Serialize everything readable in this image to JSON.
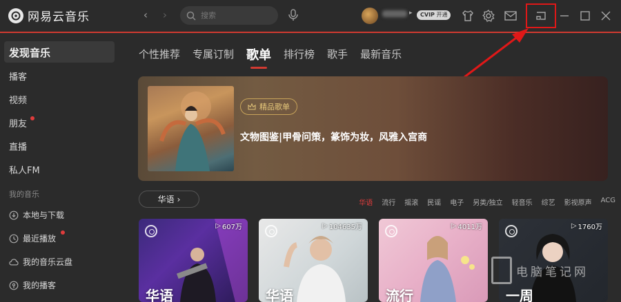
{
  "app": {
    "logo_text": "网易云音乐",
    "accent": "#d33a31"
  },
  "search": {
    "placeholder": "搜索"
  },
  "user": {
    "vip_label": "开通",
    "vip_badge": "CVIP"
  },
  "sidebar": {
    "discover": "发现音乐",
    "items": [
      {
        "label": "播客"
      },
      {
        "label": "视频"
      },
      {
        "label": "朋友"
      },
      {
        "label": "直播"
      },
      {
        "label": "私人FM"
      }
    ],
    "my_music_header": "我的音乐",
    "my_music": [
      {
        "label": "本地与下载"
      },
      {
        "label": "最近播放"
      },
      {
        "label": "我的音乐云盘"
      },
      {
        "label": "我的播客"
      }
    ]
  },
  "tabs": [
    {
      "label": "个性推荐"
    },
    {
      "label": "专属订制"
    },
    {
      "label": "歌单"
    },
    {
      "label": "排行榜"
    },
    {
      "label": "歌手"
    },
    {
      "label": "最新音乐"
    }
  ],
  "banner": {
    "badge": "精品歌单",
    "title": "文物图鉴|甲骨问策，篆饰为妆，风雅入宫商"
  },
  "category_button": "华语",
  "categories": [
    "华语",
    "流行",
    "摇滚",
    "民谣",
    "电子",
    "另类/独立",
    "轻音乐",
    "综艺",
    "影视原声",
    "ACG"
  ],
  "cards": [
    {
      "plays": "607万",
      "label": "华语"
    },
    {
      "plays": "104635万",
      "label": "华语"
    },
    {
      "plays": "4011万",
      "label": "流行"
    },
    {
      "plays": "1760万",
      "label": "一周"
    }
  ],
  "watermark": {
    "text": "电脑笔记网"
  }
}
